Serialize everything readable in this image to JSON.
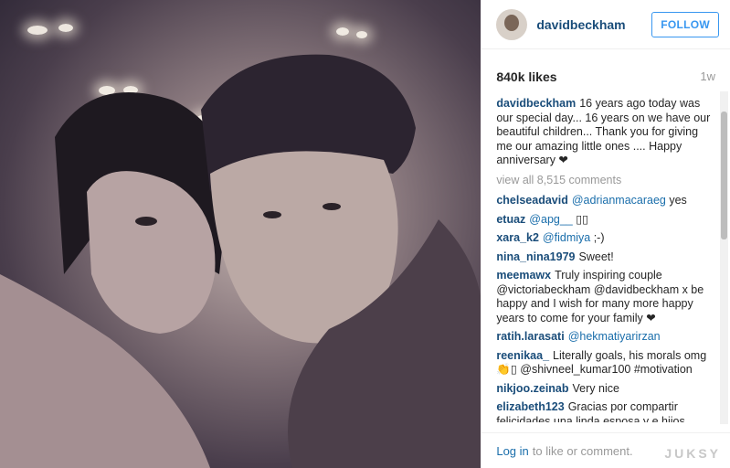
{
  "header": {
    "username": "davidbeckham",
    "follow_label": "FOLLOW"
  },
  "post": {
    "likes": "840k likes",
    "time_ago": "1w"
  },
  "caption": {
    "username": "davidbeckham",
    "text": "16 years ago today was our special day... 16 years on we have our beautiful children... Thank you for giving me our amazing little ones .... Happy anniversary ❤"
  },
  "view_all": "view all 8,515 comments",
  "comments": [
    {
      "user": "chelseadavid",
      "mention": "@adrianmacaraeg",
      "text": "yes"
    },
    {
      "user": "etuaz",
      "mention": "@apg__",
      "text": "▯▯"
    },
    {
      "user": "xara_k2",
      "mention": "@fidmiya",
      "text": ";-)"
    },
    {
      "user": "nina_nina1979",
      "mention": "",
      "text": "Sweet!"
    },
    {
      "user": "meemawx",
      "mention": "",
      "text": "Truly inspiring couple @victoriabeckham @davidbeckham x be happy and I wish for many more happy years to come for your family ❤"
    },
    {
      "user": "ratih.larasati",
      "mention": "@hekmatiyarirzan",
      "text": ""
    },
    {
      "user": "reenikaa_",
      "mention": "",
      "text": "Literally goals, his morals omg 👏▯ @shivneel_kumar100 #motivation"
    },
    {
      "user": "nikjoo.zeinab",
      "mention": "",
      "text": "Very nice"
    },
    {
      "user": "elizabeth123",
      "mention": "",
      "text": "Gracias por compartir felicidades una linda esposa y e hijos @davidbeckham"
    }
  ],
  "footer": {
    "login_label": "Log in",
    "login_suffix": "to like or comment."
  },
  "watermark": "JUKSY"
}
